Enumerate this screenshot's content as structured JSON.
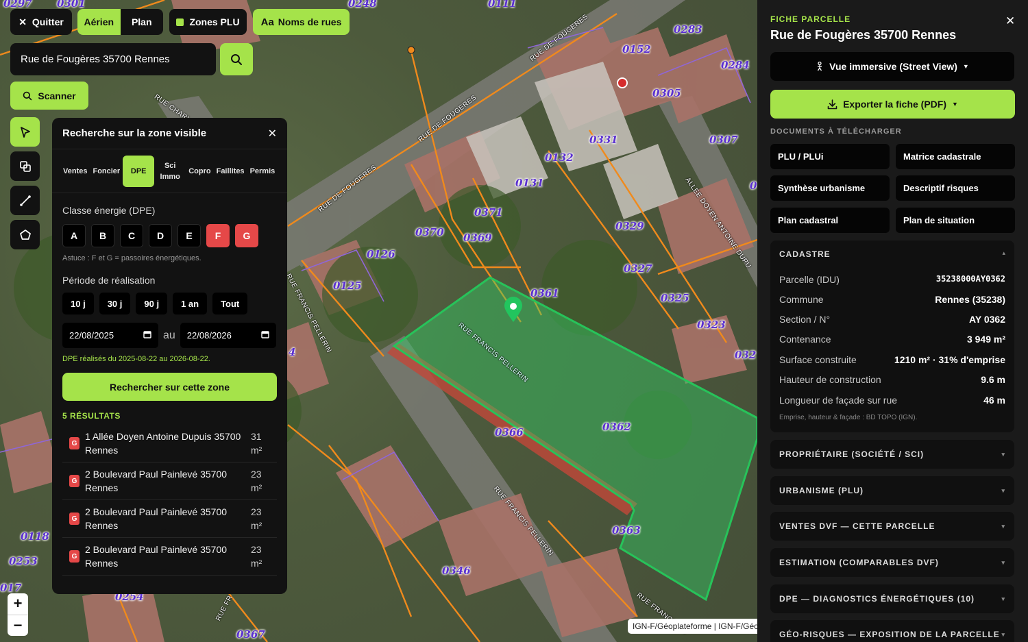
{
  "toolbar": {
    "quit_label": "Quitter",
    "map_types": [
      "Aérien",
      "Plan"
    ],
    "zones_label": "Zones PLU",
    "streets_icon_text": "Aa",
    "streets_label": "Noms de rues"
  },
  "search": {
    "value": "Rue de Fougères 35700 Rennes"
  },
  "scan_label": "Scanner",
  "zoom": {
    "in": "+",
    "out": "−"
  },
  "attribution": "IGN-F/Géoplateforme | IGN-F/Géo",
  "map_labels": {
    "parcels": [
      "0297",
      "0301",
      "0248",
      "0111",
      "0283",
      "0152",
      "0284",
      "0305",
      "0307",
      "0331",
      "0132",
      "0131",
      "0329",
      "0371",
      "0370",
      "0369",
      "0126",
      "0125",
      "0361",
      "0327",
      "0325",
      "0323",
      "032",
      "0362",
      "0366",
      "0363",
      "0346",
      "0118",
      "0253",
      "017",
      "0254",
      "0367",
      "4",
      "0"
    ],
    "streets": [
      "RUE DE FOUGERES",
      "RUE DE FOUGERES",
      "RUE DE FOUGERES",
      "RUE CHARL",
      "ALLEE DOYEN ANTOINE DUPU",
      "RUE FRANCIS PELLERIN",
      "RUE FRANCIS PELLERIN",
      "RUE FRANCIS PELLERIN",
      "RUE FRANCIS PE",
      "RUE FR"
    ]
  },
  "zone_panel": {
    "title": "Recherche sur la zone visible",
    "tabs": [
      "Ventes",
      "Foncier",
      "DPE",
      "Sci Immo",
      "Copro",
      "Faillites",
      "Permis"
    ],
    "active_tab": "DPE",
    "energy_label": "Classe énergie (DPE)",
    "classes": [
      "A",
      "B",
      "C",
      "D",
      "E",
      "F",
      "G"
    ],
    "selected_classes": [
      "F",
      "G"
    ],
    "tip": "Astuce : F et G = passoires énergétiques.",
    "period_label": "Période de réalisation",
    "periods": [
      "10 j",
      "30 j",
      "90 j",
      "1 an",
      "Tout"
    ],
    "date_from": "22/08/2025",
    "date_sep": "au",
    "date_to": "22/08/2026",
    "note": "DPE réalisés du 2025-08-22 au 2026-08-22.",
    "search_button": "Rechercher sur cette zone",
    "results_title": "5 RÉSULTATS",
    "results": [
      {
        "badge": "G",
        "address": "1 Allée Doyen Antoine Dupuis 35700 Rennes",
        "area": "31 m²"
      },
      {
        "badge": "G",
        "address": "2 Boulevard Paul Painlevé 35700 Rennes",
        "area": "23 m²"
      },
      {
        "badge": "G",
        "address": "2 Boulevard Paul Painlevé 35700 Rennes",
        "area": "23 m²"
      },
      {
        "badge": "G",
        "address": "2 Boulevard Paul Painlevé 35700 Rennes",
        "area": "23 m²"
      }
    ]
  },
  "sidebar": {
    "kicker": "FICHE PARCELLE",
    "title": "Rue de Fougères 35700 Rennes",
    "streetview_label": "Vue immersive (Street View)",
    "export_label": "Exporter la fiche (PDF)",
    "docs_label": "DOCUMENTS À TÉLÉCHARGER",
    "docs": [
      "PLU / PLUi",
      "Matrice cadastrale",
      "Synthèse urbanisme",
      "Descriptif risques",
      "Plan cadastral",
      "Plan de situation"
    ],
    "cadastre": {
      "title": "CADASTRE",
      "rows": [
        {
          "k": "Parcelle (IDU)",
          "v": "35238000AY0362"
        },
        {
          "k": "Commune",
          "v": "Rennes (35238)"
        },
        {
          "k": "Section / N°",
          "v": "AY 0362"
        },
        {
          "k": "Contenance",
          "v": "3 949 m²"
        },
        {
          "k": "Surface construite",
          "v": "1210 m² · 31% d'emprise"
        },
        {
          "k": "Hauteur de construction",
          "v": "9.6 m"
        },
        {
          "k": "Longueur de façade sur rue",
          "v": "46 m"
        }
      ],
      "note": "Emprise, hauteur & façade : BD TOPO (IGN)."
    },
    "sections": [
      "PROPRIÉTAIRE (SOCIÉTÉ / SCI)",
      "URBANISME (PLU)",
      "VENTES DVF — CETTE PARCELLE",
      "ESTIMATION (COMPARABLES DVF)",
      "DPE — DIAGNOSTICS ÉNERGÉTIQUES (10)",
      "GÉO-RISQUES — EXPOSITION DE LA PARCELLE"
    ]
  },
  "colors": {
    "accent": "#a5e34a",
    "danger": "#e54848",
    "parcel_label": "#5a2fd0",
    "parcel_line": "#f08a1c"
  }
}
